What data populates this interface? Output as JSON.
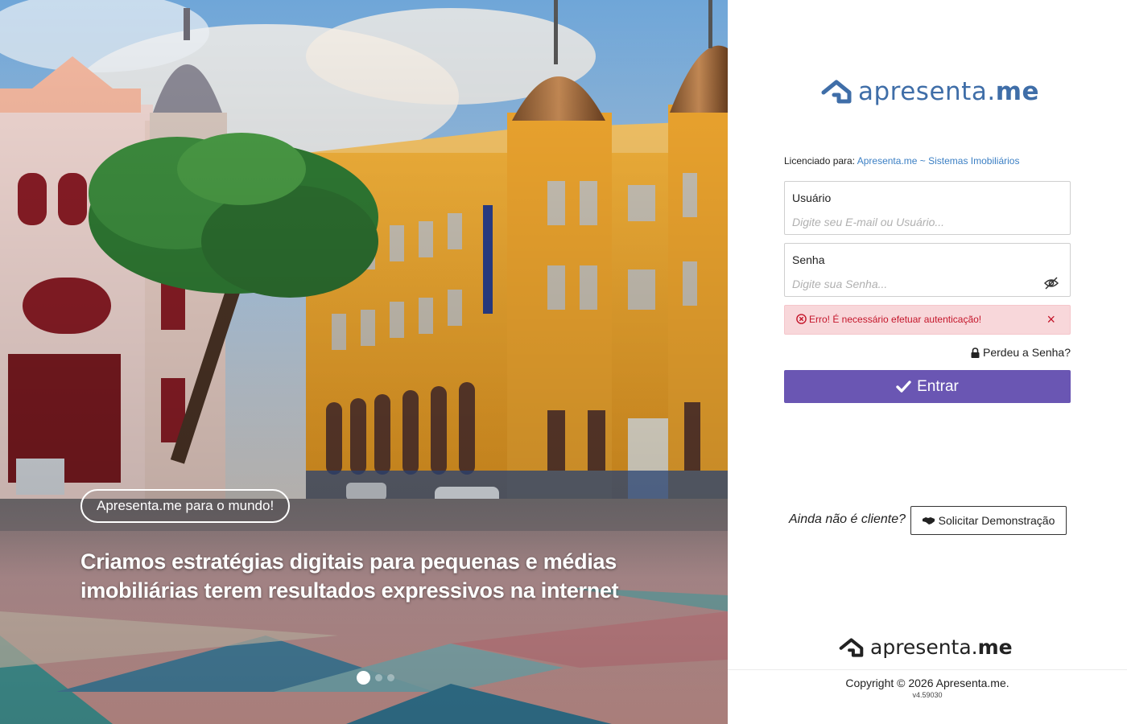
{
  "hero": {
    "badge": "Apresenta.me para o mundo!",
    "headline": "Criamos estratégias digitais para pequenas e médias imobiliárias terem resultados expressivos na internet",
    "slides": 3,
    "active_slide": 1
  },
  "brand": {
    "logo_regular": "apresenta",
    "logo_dot": ".",
    "logo_bold": "me",
    "logo_color": "#3f6ea8",
    "accent_color": "#6a56b3"
  },
  "login": {
    "licensed_label": "Licenciado para:",
    "licensed_name": "Apresenta.me ~ Sistemas Imobiliários",
    "user_label": "Usuário",
    "user_placeholder": "Digite seu E-mail ou Usuário...",
    "user_value": "",
    "password_label": "Senha",
    "password_placeholder": "Digite sua Senha...",
    "password_value": "",
    "password_toggle_icon": "eye-slash-icon",
    "error_message": "Erro! É necessário efetuar autenticação!",
    "error_close": "×",
    "forgot_password": "Perdeu a Senha?",
    "submit_label": "Entrar"
  },
  "demo": {
    "question": "Ainda não é cliente?",
    "button_label": "Solicitar Demonstração"
  },
  "footer": {
    "copyright": "Copyright © 2026 Apresenta.me.",
    "version": "v4.59030"
  }
}
